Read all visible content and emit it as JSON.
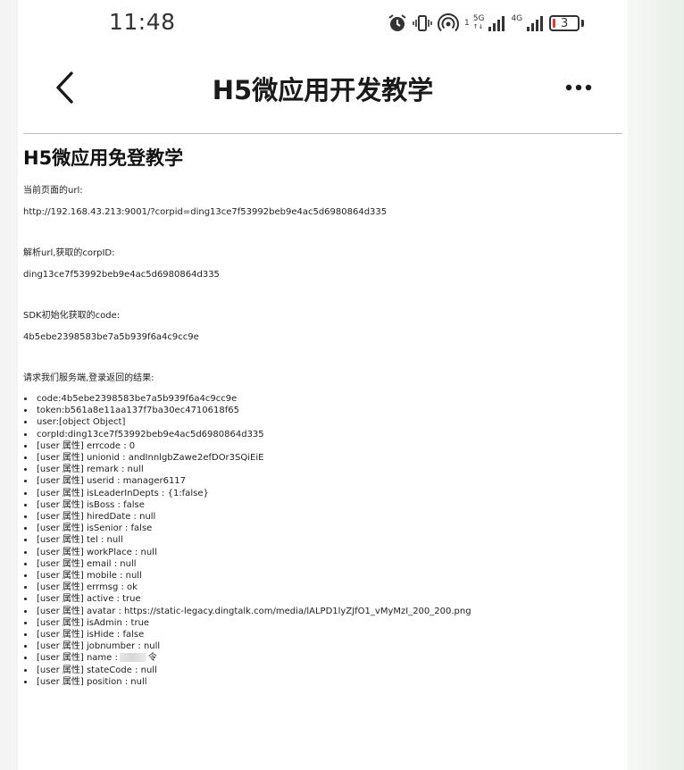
{
  "status_bar": {
    "time": "11:48",
    "network_1": "5G",
    "network_2": "4G",
    "sim_1": "1",
    "battery": "3"
  },
  "nav": {
    "title": "H5微应用开发教学",
    "back_icon": "chevron-left-icon",
    "more_icon": "more-horizontal-icon"
  },
  "page": {
    "heading": "H5微应用免登教学",
    "url_label": "当前页面的url:",
    "url_value": "http://192.168.43.213:9001/?corpid=ding13ce7f53992beb9e4ac5d6980864d335",
    "corpid_label": "解析url,获取的corpID:",
    "corpid_value": "ding13ce7f53992beb9e4ac5d6980864d335",
    "code_label": "SDK初始化获取的code:",
    "code_value": "4b5ebe2398583be7a5b939f6a4c9cc9e",
    "result_label": "请求我们服务端,登录返回的结果:",
    "results": [
      "code:4b5ebe2398583be7a5b939f6a4c9cc9e",
      "token:b561a8e11aa137f7ba30ec4710618f65",
      "user:[object Object]",
      "corpId:ding13ce7f53992beb9e4ac5d6980864d335",
      "[user 属性] errcode : 0",
      "[user 属性] unionid : andInnlgbZawe2efDOr3SQiEiE",
      "[user 属性] remark : null",
      "[user 属性] userid : manager6117",
      "[user 属性] isLeaderInDepts : {1:false}",
      "[user 属性] isBoss : false",
      "[user 属性] hiredDate : null",
      "[user 属性] isSenior : false",
      "[user 属性] tel : null",
      "[user 属性] workPlace : null",
      "[user 属性] email : null",
      "[user 属性] mobile : null",
      "[user 属性] errmsg : ok",
      "[user 属性] active : true",
      "[user 属性] avatar : https://static-legacy.dingtalk.com/media/lALPD1lyZJfO1_vMyMzI_200_200.png",
      "[user 属性] isAdmin : true",
      "[user 属性] isHide : false",
      "[user 属性] jobnumber : null",
      "[user 属性] name :",
      "[user 属性] stateCode : null",
      "[user 属性] position : null"
    ],
    "name_suffix": "令"
  }
}
